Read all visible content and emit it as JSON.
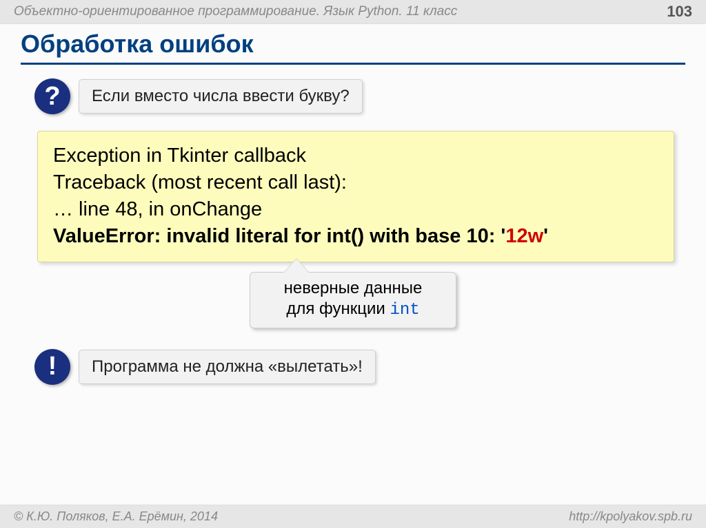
{
  "header": {
    "subject": "Объектно-ориентированное программирование. Язык Python. 11 класс",
    "slide_number": "103"
  },
  "title": "Обработка ошибок",
  "question": {
    "icon": "?",
    "text": "Если вместо числа ввести букву?"
  },
  "traceback": {
    "line1": "Exception in Tkinter callback",
    "line2": "Traceback (most recent call last):",
    "line3": "… line 48, in onChange",
    "error_prefix": "ValueError: invalid literal for int() with base 10: '",
    "error_value": "12w",
    "error_suffix": "'"
  },
  "tip": {
    "line1": "неверные данные",
    "line2_pre": "для функции ",
    "line2_code": "int"
  },
  "warning": {
    "icon": "!",
    "text": "Программа не должна «вылетать»!"
  },
  "footer": {
    "authors": "© К.Ю. Поляков, Е.А. Ерёмин, 2014",
    "url": "http://kpolyakov.spb.ru"
  }
}
